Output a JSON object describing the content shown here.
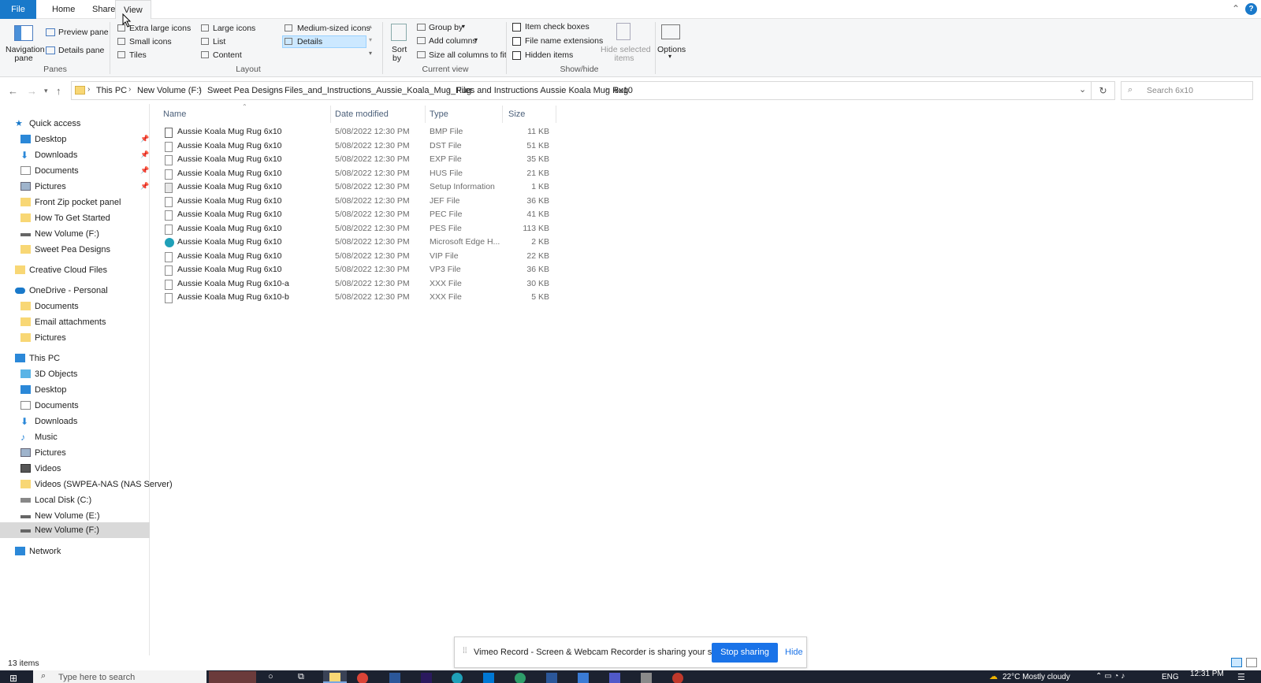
{
  "ribbon_tabs": {
    "file": "File",
    "home": "Home",
    "share": "Share",
    "view": "View"
  },
  "help_icon": "?",
  "ribbon": {
    "panes": {
      "navigation_pane": "Navigation",
      "navigation_pane2": "pane",
      "preview_pane": "Preview pane",
      "details_pane": "Details pane",
      "group_label": "Panes"
    },
    "layout": {
      "extra_large_icons": "Extra large icons",
      "large_icons": "Large icons",
      "medium_icons": "Medium-sized icons",
      "small_icons": "Small icons",
      "list": "List",
      "details": "Details",
      "tiles": "Tiles",
      "content": "Content",
      "group_label": "Layout"
    },
    "current_view": {
      "sort_by": "Sort",
      "sort_by2": "by",
      "group_by": "Group by",
      "add_columns": "Add columns",
      "size_columns": "Size all columns to fit",
      "group_label": "Current view"
    },
    "show_hide": {
      "item_check_boxes": "Item check boxes",
      "file_name_extensions": "File name extensions",
      "hidden_items": "Hidden items",
      "hide_selected": "Hide selected",
      "hide_selected2": "items",
      "group_label": "Show/hide"
    },
    "options": "Options"
  },
  "breadcrumb": [
    "This PC",
    "New Volume (F:)",
    "Sweet Pea Designs",
    "Files_and_Instructions_Aussie_Koala_Mug_Rug",
    "Files and Instructions Aussie Koala Mug Rug",
    "6x10"
  ],
  "search": {
    "placeholder": "Search 6x10"
  },
  "nav": {
    "quick_access": "Quick access",
    "quick_items": [
      "Desktop",
      "Downloads",
      "Documents",
      "Pictures",
      "Front Zip pocket panel",
      "How To Get Started",
      "New Volume (F:)",
      "Sweet Pea Designs"
    ],
    "creative_cloud": "Creative Cloud Files",
    "onedrive": "OneDrive - Personal",
    "onedrive_items": [
      "Documents",
      "Email attachments",
      "Pictures"
    ],
    "this_pc": "This PC",
    "pc_items": [
      "3D Objects",
      "Desktop",
      "Documents",
      "Downloads",
      "Music",
      "Pictures",
      "Videos",
      "Videos (SWPEA-NAS (NAS Server)",
      "Local Disk (C:)",
      "New Volume (E:)",
      "New Volume (F:)"
    ],
    "network": "Network"
  },
  "columns": {
    "name": "Name",
    "date": "Date modified",
    "type": "Type",
    "size": "Size"
  },
  "files": [
    {
      "name": "Aussie Koala Mug Rug 6x10",
      "date": "5/08/2022 12:30 PM",
      "type": "BMP File",
      "size": "11 KB"
    },
    {
      "name": "Aussie Koala Mug Rug 6x10",
      "date": "5/08/2022 12:30 PM",
      "type": "DST File",
      "size": "51 KB"
    },
    {
      "name": "Aussie Koala Mug Rug 6x10",
      "date": "5/08/2022 12:30 PM",
      "type": "EXP File",
      "size": "35 KB"
    },
    {
      "name": "Aussie Koala Mug Rug 6x10",
      "date": "5/08/2022 12:30 PM",
      "type": "HUS File",
      "size": "21 KB"
    },
    {
      "name": "Aussie Koala Mug Rug 6x10",
      "date": "5/08/2022 12:30 PM",
      "type": "Setup Information",
      "size": "1 KB"
    },
    {
      "name": "Aussie Koala Mug Rug 6x10",
      "date": "5/08/2022 12:30 PM",
      "type": "JEF File",
      "size": "36 KB"
    },
    {
      "name": "Aussie Koala Mug Rug 6x10",
      "date": "5/08/2022 12:30 PM",
      "type": "PEC File",
      "size": "41 KB"
    },
    {
      "name": "Aussie Koala Mug Rug 6x10",
      "date": "5/08/2022 12:30 PM",
      "type": "PES File",
      "size": "113 KB"
    },
    {
      "name": "Aussie Koala Mug Rug 6x10",
      "date": "5/08/2022 12:30 PM",
      "type": "Microsoft Edge H...",
      "size": "2 KB"
    },
    {
      "name": "Aussie Koala Mug Rug 6x10",
      "date": "5/08/2022 12:30 PM",
      "type": "VIP File",
      "size": "22 KB"
    },
    {
      "name": "Aussie Koala Mug Rug 6x10",
      "date": "5/08/2022 12:30 PM",
      "type": "VP3 File",
      "size": "36 KB"
    },
    {
      "name": "Aussie Koala Mug Rug 6x10-a",
      "date": "5/08/2022 12:30 PM",
      "type": "XXX File",
      "size": "30 KB"
    },
    {
      "name": "Aussie Koala Mug Rug 6x10-b",
      "date": "5/08/2022 12:30 PM",
      "type": "XXX File",
      "size": "5 KB"
    }
  ],
  "status": "13 items",
  "banner": {
    "text": "Vimeo Record - Screen & Webcam Recorder is sharing your screen.",
    "stop": "Stop sharing",
    "hide": "Hide"
  },
  "taskbar": {
    "search_placeholder": "Type here to search",
    "weather": "22°C  Mostly cloudy",
    "lang": "ENG",
    "time": "12:31 PM"
  },
  "colors": {
    "accent": "#1979ca",
    "selected": "#cce8ff",
    "folder": "#f8d775",
    "taskbar": "#1c2230"
  }
}
